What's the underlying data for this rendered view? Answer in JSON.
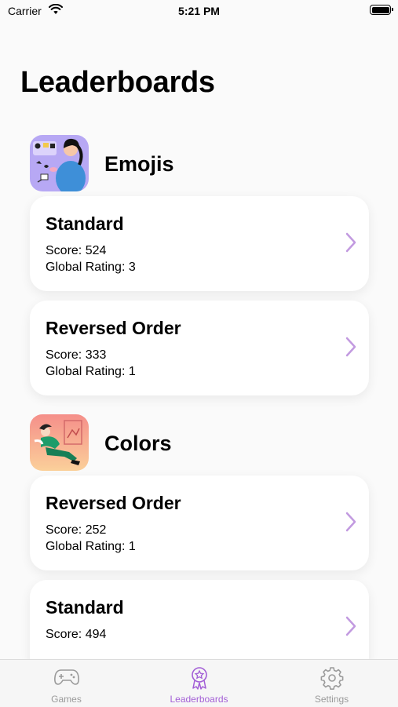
{
  "status_bar": {
    "carrier": "Carrier",
    "time": "5:21 PM"
  },
  "page_title": "Leaderboards",
  "sections": [
    {
      "title": "Emojis",
      "cards": [
        {
          "title": "Standard",
          "score": "Score: 524",
          "rating": "Global Rating: 3"
        },
        {
          "title": "Reversed Order",
          "score": "Score: 333",
          "rating": "Global Rating: 1"
        }
      ]
    },
    {
      "title": "Colors",
      "cards": [
        {
          "title": "Reversed Order",
          "score": "Score: 252",
          "rating": "Global Rating: 1"
        },
        {
          "title": "Standard",
          "score": "Score: 494",
          "rating": ""
        }
      ]
    }
  ],
  "tabs": [
    {
      "label": "Games",
      "icon": "gamepad-icon",
      "active": false
    },
    {
      "label": "Leaderboards",
      "icon": "award-icon",
      "active": true
    },
    {
      "label": "Settings",
      "icon": "gear-icon",
      "active": false
    }
  ],
  "colors": {
    "accent": "#a35fd6",
    "chevron": "#c29ae0",
    "inactive": "#9a9a9a",
    "background": "#fafafa"
  }
}
